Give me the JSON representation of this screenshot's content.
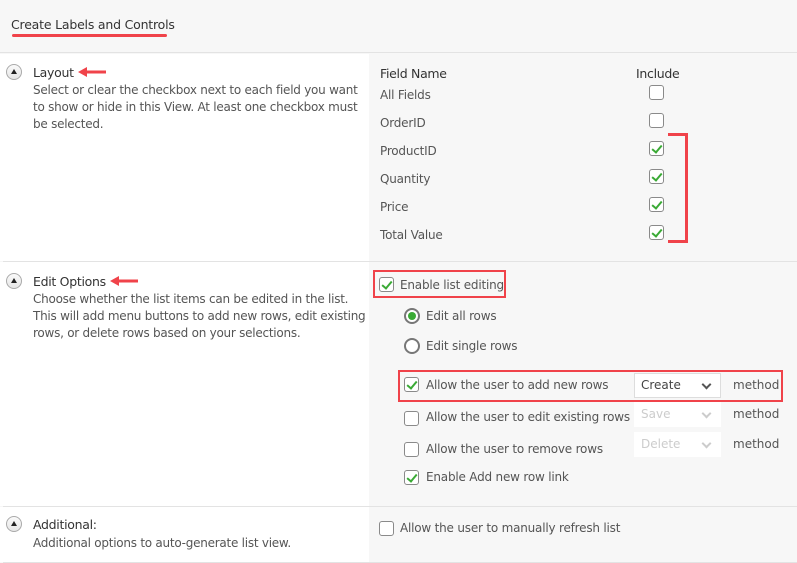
{
  "header": {
    "title": "Create Labels and Controls"
  },
  "colors": {
    "accent_red": "#f0434a",
    "check_green": "#3aaa35"
  },
  "layout_section": {
    "title": "Layout",
    "description": "Select or clear the checkbox next to each field you want to show or hide in this View. At least one checkbox must be selected.",
    "column_headers": {
      "field_name": "Field Name",
      "include": "Include"
    },
    "fields": [
      {
        "name": "All Fields",
        "included": false
      },
      {
        "name": "OrderID",
        "included": false
      },
      {
        "name": "ProductID",
        "included": true
      },
      {
        "name": "Quantity",
        "included": true
      },
      {
        "name": "Price",
        "included": true
      },
      {
        "name": "Total Value",
        "included": true
      }
    ]
  },
  "edit_options_section": {
    "title": "Edit Options",
    "description": "Choose whether the list items can be edited in the list. This will add menu buttons to add new rows, edit existing rows, or delete rows based on your selections.",
    "enable_list_editing": {
      "label": "Enable list editing",
      "checked": true
    },
    "edit_mode": {
      "options": [
        {
          "label": "Edit all rows",
          "selected": true
        },
        {
          "label": "Edit single rows",
          "selected": false
        }
      ]
    },
    "permissions": [
      {
        "label": "Allow the user to add new rows",
        "checked": true,
        "method_value": "Create",
        "method_enabled": true,
        "suffix": "method"
      },
      {
        "label": "Allow the user to edit existing rows",
        "checked": false,
        "method_value": "Save",
        "method_enabled": false,
        "suffix": "method"
      },
      {
        "label": "Allow the user to remove rows",
        "checked": false,
        "method_value": "Delete",
        "method_enabled": false,
        "suffix": "method"
      }
    ],
    "enable_add_new_row_link": {
      "label": "Enable Add new row link",
      "checked": true
    }
  },
  "additional_section": {
    "title": "Additional:",
    "description": "Additional options to auto-generate list view.",
    "manual_refresh": {
      "label": "Allow the user to manually refresh list",
      "checked": false
    }
  }
}
